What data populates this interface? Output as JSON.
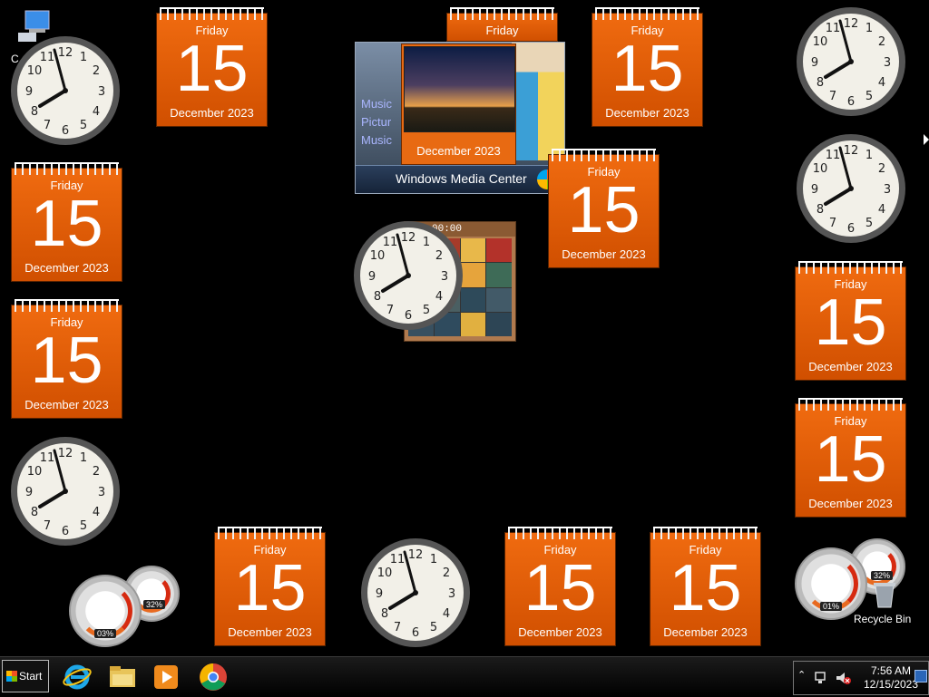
{
  "calendar": {
    "day_name": "Friday",
    "day_number": "15",
    "month_year": "December 2023",
    "color": "#e85d0a"
  },
  "media_center": {
    "title": "Windows Media Center",
    "menu": [
      "Music",
      "Pictur",
      "Music"
    ]
  },
  "slideshow": {
    "caption": "December 2023"
  },
  "puzzle": {
    "timer": "00:00"
  },
  "meters": [
    {
      "cpu": "03%",
      "memory": "32%"
    },
    {
      "cpu": "01%",
      "memory": "32%"
    }
  ],
  "desktop_icons": {
    "computer_label": "C",
    "recycle_bin_label": "Recycle Bin"
  },
  "taskbar": {
    "start_label": "Start",
    "pinned": [
      "internet-explorer-icon",
      "file-explorer-icon",
      "media-player-icon",
      "chrome-icon"
    ],
    "tray_icons": [
      "show-hidden-icons-chevron",
      "network-icon",
      "volume-muted-icon"
    ],
    "time": "7:56 AM",
    "date": "12/15/2023"
  }
}
